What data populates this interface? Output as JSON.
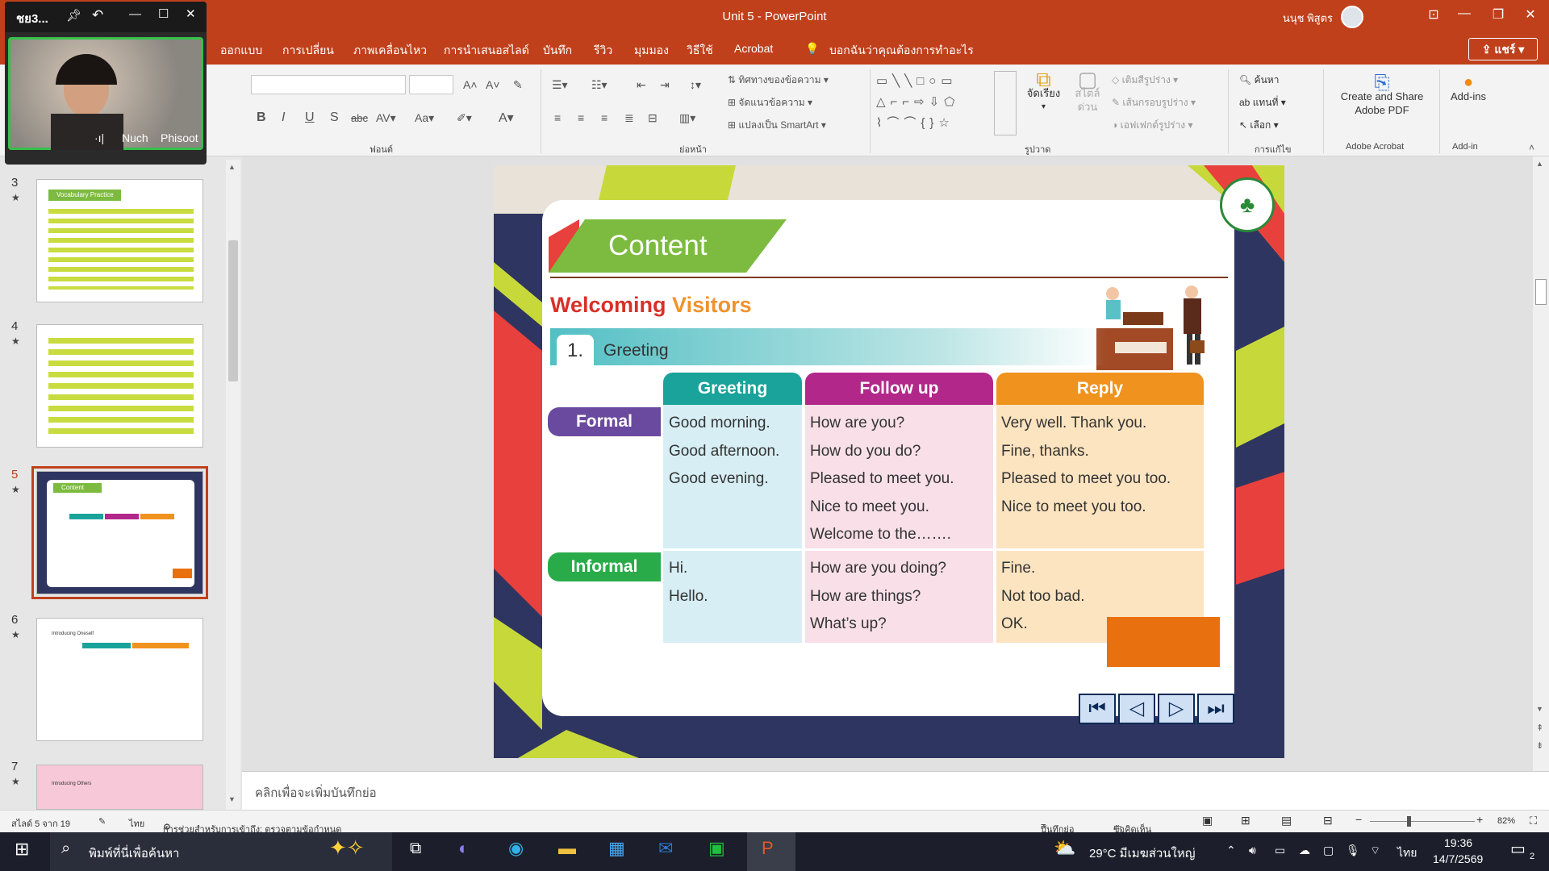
{
  "window": {
    "title": "Unit 5  -  PowerPoint",
    "user": "นนุช พิสูตร",
    "share_label": "แชร์"
  },
  "tabs": [
    "ออกแบบ",
    "การเปลี่ยน",
    "ภาพเคลื่อนไหว",
    "การนำเสนอสไลด์",
    "บันทึก",
    "รีวิว",
    "มุมมอง",
    "วิธีใช้",
    "Acrobat"
  ],
  "tell_me": "บอกฉันว่าคุณต้องการทำอะไร",
  "ribbon": {
    "group_font": "ฟอนต์",
    "group_paragraph": "ย่อหน้า",
    "group_drawing": "รูปวาด",
    "group_edit": "การแก้ไข",
    "group_acrobat": "Adobe Acrobat",
    "group_addin": "Add-in",
    "text_direction": "ทิศทางของข้อความ",
    "align_text": "จัดแนวข้อความ",
    "smartart": "แปลงเป็น SmartArt",
    "arrange": "จัดเรียง",
    "quick_styles": "สไตล์ด่วน",
    "shape_fill": "เติมสีรูปร่าง",
    "shape_outline": "เส้นกรอบรูปร่าง",
    "shape_effects": "เอฟเฟกต์รูปร่าง",
    "find": "ค้นหา",
    "replace": "แทนที่",
    "select": "เลือก",
    "create_pdf": "Create and Share Adobe PDF",
    "addins": "Add-ins"
  },
  "webcam": {
    "label": "ชย3...",
    "name_first": "Nuch",
    "name_last": "Phisoot"
  },
  "thumbnails": [
    {
      "num": "3",
      "title": "Vocabulary Practice"
    },
    {
      "num": "4",
      "title": ""
    },
    {
      "num": "5",
      "title": "Content"
    },
    {
      "num": "6",
      "title": "Introducing Oneself"
    },
    {
      "num": "7",
      "title": "Introducing Others"
    }
  ],
  "slide": {
    "heading": "Content",
    "subtitle_a": "Welcoming",
    "subtitle_b": "Visitors",
    "section_num": "1.",
    "section_title": "Greeting",
    "headers": {
      "greeting": "Greeting",
      "followup": "Follow up",
      "reply": "Reply"
    },
    "formal_label": "Formal",
    "informal_label": "Informal",
    "formal_greeting": [
      "Good morning.",
      "Good afternoon.",
      "Good evening."
    ],
    "formal_followup": [
      "How are you?",
      "How do you do?",
      "Pleased to meet you.",
      "Nice to meet you.",
      "Welcome to the……."
    ],
    "formal_reply": [
      "Very well. Thank you.",
      "Fine, thanks.",
      "Pleased to meet you too.",
      "Nice to meet you too."
    ],
    "informal_greeting": [
      "Hi.",
      "Hello."
    ],
    "informal_followup": [
      "How are you doing?",
      "How are things?",
      "What’s up?"
    ],
    "informal_reply": [
      "Fine.",
      "Not too bad.",
      "OK."
    ]
  },
  "notes_placeholder": "คลิกเพื่อจะเพิ่มบันทึกย่อ",
  "status": {
    "slide_count": "สไลด์ 5 จาก 19",
    "language": "ไทย",
    "accessibility": "การช่วยสำหรับการเข้าถึง: ตรวจตามข้อกำหนด",
    "notes": "บันทึกย่อ",
    "comments": "ข้อคิดเห็น",
    "zoom": "82%"
  },
  "taskbar": {
    "search": "พิมพ์ที่นี่เพื่อค้นหา",
    "weather": "29°C  มีเมฆส่วนใหญ่",
    "lang": "ไทย",
    "time": "19:36",
    "date": "14/7/2569",
    "notif": "2"
  },
  "colors": {
    "accent": "#c0401c",
    "teal": "#1aa39a",
    "purple": "#b2288a",
    "orange": "#f0921e",
    "formal": "#6a4a9e",
    "informal": "#2aab4a"
  }
}
